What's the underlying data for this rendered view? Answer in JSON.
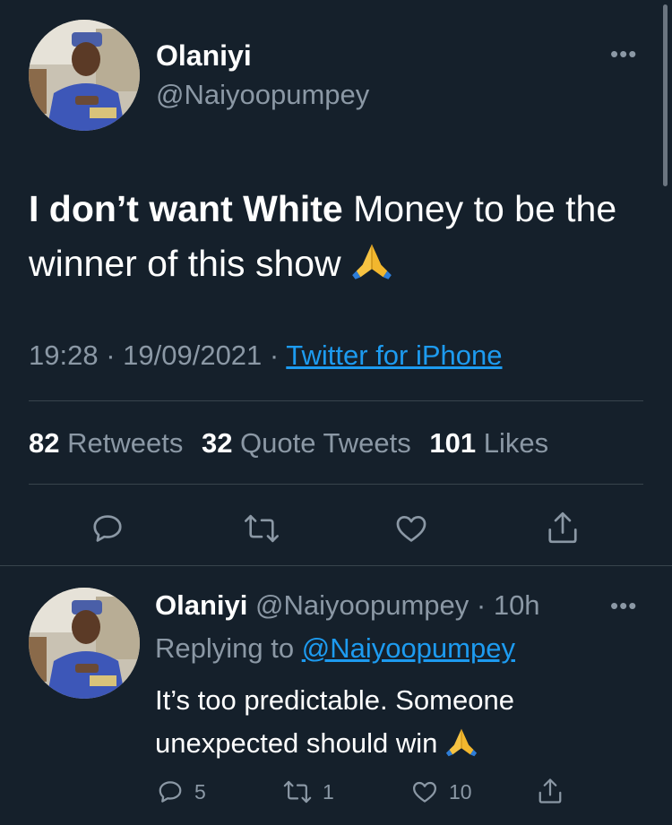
{
  "tweet": {
    "author_name": "Olaniyi",
    "handle": "@Naiyoopumpey",
    "text_bold": "I don’t want White",
    "text_rest": " Money to be the winner of this show",
    "emoji": "folded-hands",
    "time": "19:28",
    "date": "19/09/2021",
    "meta_sep": " · ",
    "source": "Twitter for iPhone",
    "retweets_count": "82",
    "retweets_label": " Retweets",
    "quotes_count": "32",
    "quotes_label": " Quote Tweets",
    "likes_count": "101",
    "likes_label": " Likes"
  },
  "reply": {
    "author_name": "Olaniyi",
    "handle": "@Naiyoopumpey",
    "time_sep": " · ",
    "time": "10h",
    "replying_label": "Replying to ",
    "replying_handle": "@Naiyoopumpey",
    "text": "It’s too predictable. Someone unexpected should win",
    "emoji": "folded-hands",
    "reply_count": "5",
    "retweet_count": "1",
    "like_count": "10"
  },
  "icons": {
    "reply": "reply-icon",
    "retweet": "retweet-icon",
    "like": "heart-icon",
    "share": "share-icon",
    "more": "more-icon"
  },
  "colors": {
    "background": "#15202b",
    "text": "#ffffff",
    "muted": "#8b98a5",
    "link": "#1d9bf0",
    "divider": "#38444d"
  }
}
